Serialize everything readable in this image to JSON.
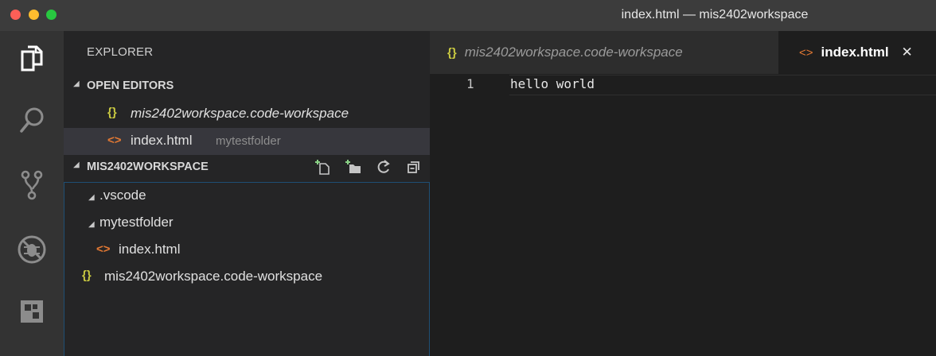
{
  "window": {
    "title": "index.html — mis2402workspace"
  },
  "activity_bar": {
    "icons": [
      "explorer-icon",
      "search-icon",
      "source-control-icon",
      "debug-icon",
      "extensions-icon"
    ]
  },
  "sidebar": {
    "title": "EXPLORER",
    "open_editors": {
      "header": "OPEN EDITORS",
      "items": [
        {
          "icon": "{}",
          "name": "mis2402workspace.code-workspace",
          "detail": ""
        },
        {
          "icon": "<>",
          "name": "index.html",
          "detail": "mytestfolder"
        }
      ]
    },
    "workspace": {
      "header": "MIS2402WORKSPACE",
      "action_icons": [
        "new-file-icon",
        "new-folder-icon",
        "refresh-icon",
        "collapse-all-icon"
      ],
      "tree": [
        {
          "label": ".vscode"
        },
        {
          "label": "mytestfolder"
        },
        {
          "icon": "<>",
          "label": "index.html"
        },
        {
          "icon": "{}",
          "label": "mis2402workspace.code-workspace"
        }
      ]
    }
  },
  "editor": {
    "tabs": [
      {
        "icon": "{}",
        "label": "mis2402workspace.code-workspace"
      },
      {
        "icon": "<>",
        "label": "index.html",
        "close": "✕"
      }
    ],
    "lines": [
      {
        "number": "1",
        "text": "hello world"
      }
    ]
  },
  "colors": {
    "accent_json": "#cbcb41",
    "accent_html": "#e37933",
    "tree_focus_border": "#1f4f74"
  }
}
